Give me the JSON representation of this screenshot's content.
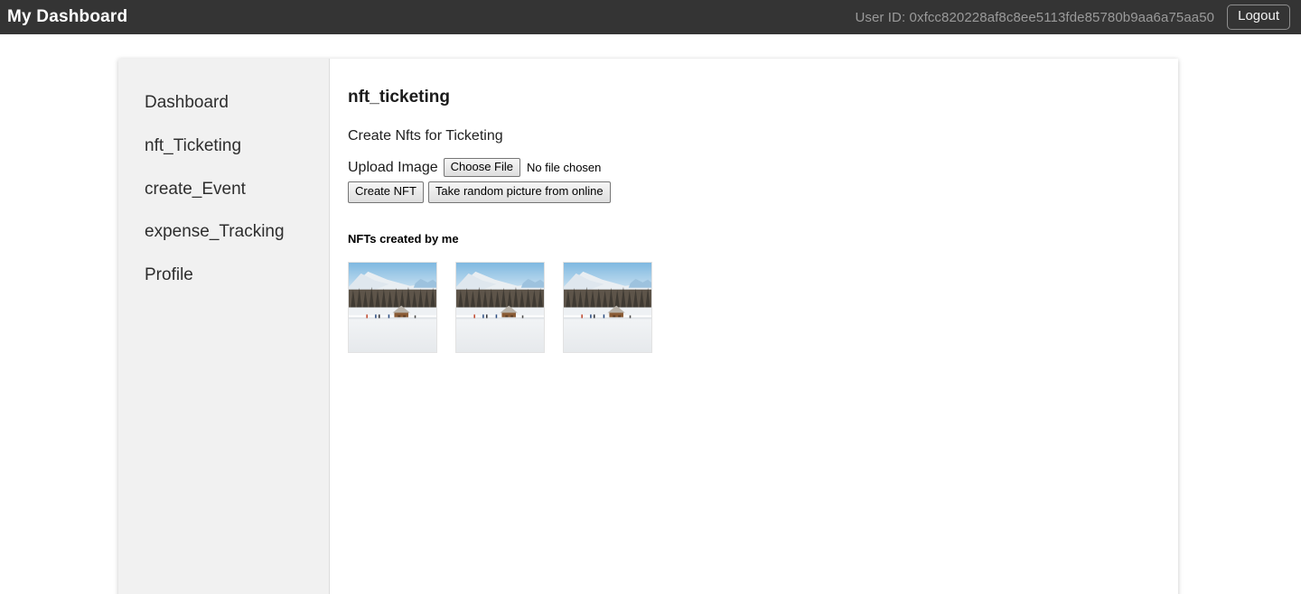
{
  "header": {
    "brand": "My Dashboard",
    "user_id_label": "User ID: 0xfcc820228af8c8ee5113fde85780b9aa6a75aa50",
    "logout_label": "Logout",
    "bar_color": "#343434",
    "brand_color": "#ffffff",
    "user_id_color": "#9a9a9a"
  },
  "sidebar": {
    "background": "#f1f1f1",
    "items": [
      {
        "label": "Dashboard",
        "name": "dashboard"
      },
      {
        "label": "nft_Ticketing",
        "name": "nft-ticketing"
      },
      {
        "label": "create_Event",
        "name": "create-event"
      },
      {
        "label": "expense_Tracking",
        "name": "expense-tracking"
      },
      {
        "label": "Profile",
        "name": "profile"
      }
    ]
  },
  "main": {
    "title": "nft_ticketing",
    "subtitle": "Create Nfts for Ticketing",
    "upload": {
      "label": "Upload Image",
      "choose_file_label": "Choose File",
      "file_status": "No file chosen"
    },
    "actions": {
      "create_nft_label": "Create NFT",
      "random_picture_label": "Take random picture from online"
    },
    "nft_list": {
      "heading": "NFTs created by me",
      "items": [
        {
          "alt": "snowy-mountain-cabin-thumbnail"
        },
        {
          "alt": "snowy-mountain-cabin-thumbnail"
        },
        {
          "alt": "snowy-mountain-cabin-thumbnail"
        }
      ]
    }
  }
}
